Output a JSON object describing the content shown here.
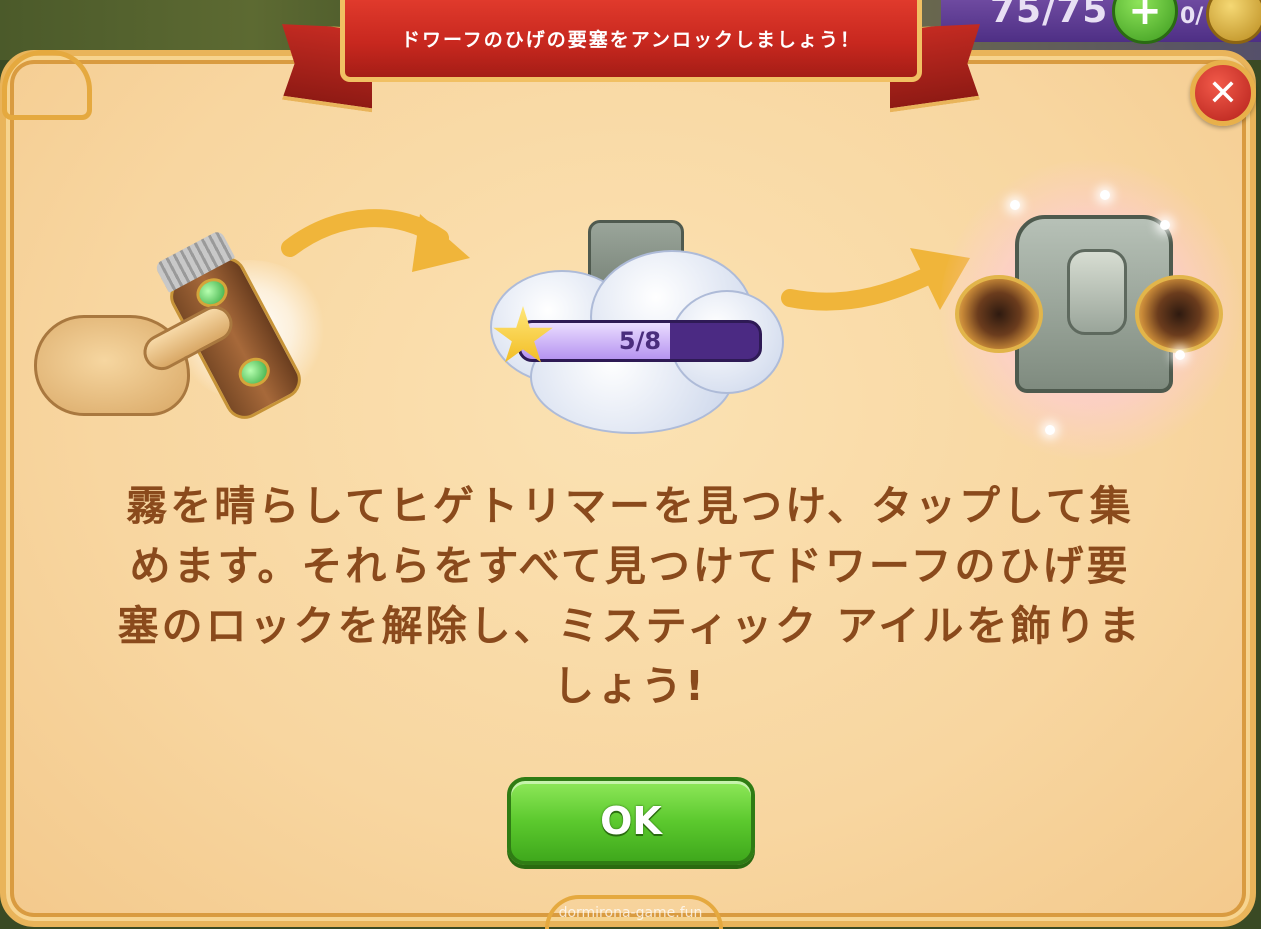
{
  "hud": {
    "energy": "75/75",
    "plus_label": "+",
    "secondary_count": "0/"
  },
  "dialog": {
    "title": "ドワーフのひげの要塞をアンロックしましょう！",
    "close_label": "✕",
    "progress": {
      "label": "5/8",
      "current": 5,
      "total": 8
    },
    "description_lines": [
      "霧を晴らしてヒゲトリマーを見つけ、タップして集",
      "めます。それらをすべて見つけてドワーフのひげ要",
      "塞のロックを解除し、ミスティック アイルを飾りま",
      "しょう!"
    ],
    "ok_label": "OK"
  },
  "watermark": "dormirona-game.fun",
  "colors": {
    "panel": "#f8d6a0",
    "ribbon": "#c8281f",
    "text": "#8a4a1c",
    "ok_button": "#5cc92e",
    "progress_bar": "#4b2a83"
  },
  "icons": [
    "hand-pointer-icon",
    "beard-trimmer-icon",
    "arrow-right-icon",
    "fog-cloud-icon",
    "star-icon",
    "dwarf-beard-fortress-icon",
    "close-icon",
    "plus-icon",
    "coin-icon"
  ]
}
